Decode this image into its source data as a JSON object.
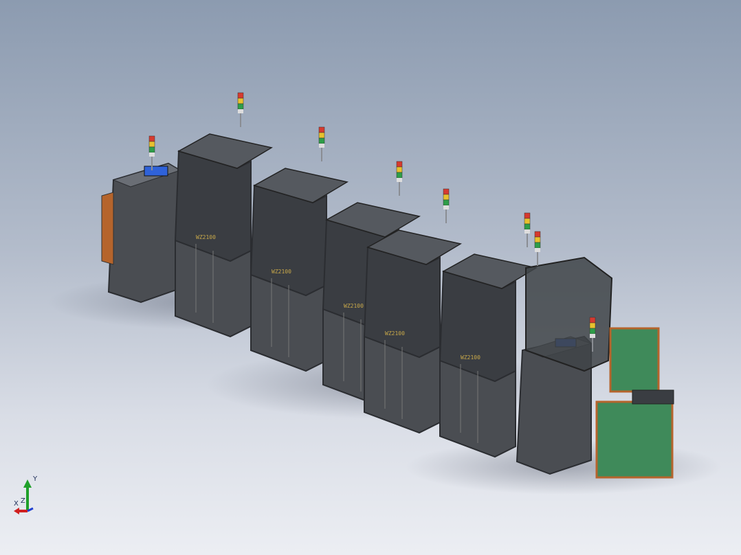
{
  "viewport": {
    "background_top": "#8c9bb0",
    "background_bottom": "#eceef3"
  },
  "model": {
    "station_label": "WZ2100",
    "panel_color": "#4a4d52",
    "frame_color": "#2b2d31",
    "screen_color": "#2f62d9",
    "tray_green": "#3f8a5a",
    "tray_orange": "#b5642c"
  },
  "signal_tower": {
    "colors": [
      "#d63a2f",
      "#e8c12e",
      "#2e9d48"
    ]
  },
  "triad": {
    "x_label": "X",
    "y_label": "Y",
    "z_label": "Z",
    "x_color": "#d02020",
    "y_color": "#1fa02a",
    "z_color": "#2040d0"
  }
}
